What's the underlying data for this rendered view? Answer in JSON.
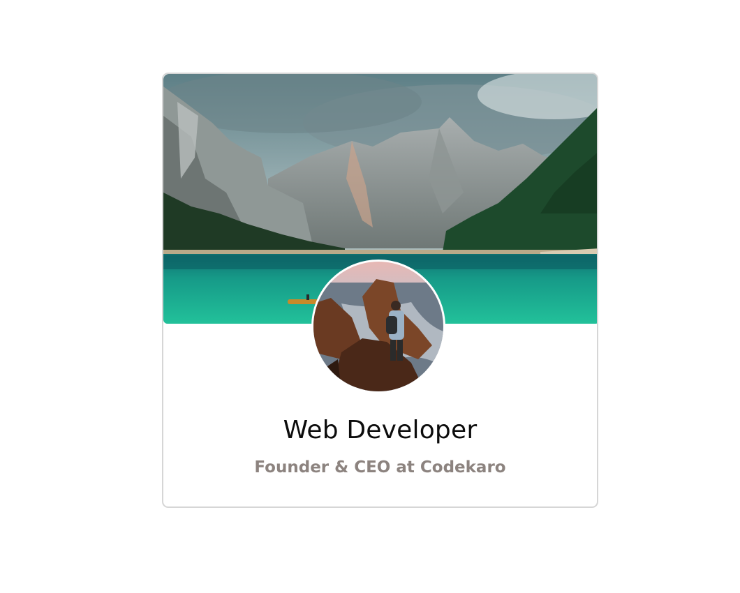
{
  "profile_card": {
    "name": "Web Developer",
    "title": "Founder & CEO at Codekaro",
    "cover_image": "mountain-lake-landscape",
    "avatar_image": "hiker-on-sea-rocks"
  },
  "colors": {
    "card_border": "#d6d6d6",
    "name_text": "#0c0c0c",
    "title_text": "#8c837f",
    "lake": "#1fb494",
    "background": "#ffffff"
  }
}
